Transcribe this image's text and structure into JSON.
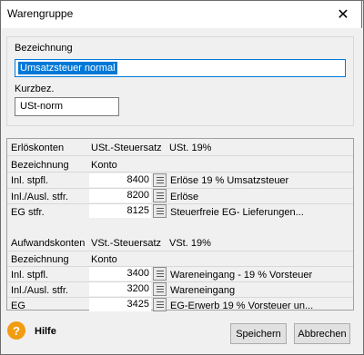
{
  "window": {
    "title": "Warengruppe",
    "close": "✕"
  },
  "form": {
    "bezeichnung_label": "Bezeichnung",
    "bezeichnung_value": "Umsatzsteuer normal",
    "kurzbez_label": "Kurzbez.",
    "kurzbez_value": "USt-norm"
  },
  "erloes": {
    "header_col1": "Erlöskonten",
    "header_col2": "USt.-Steuersatz",
    "header_col3": "USt. 19%",
    "sub_col1": "Bezeichnung",
    "sub_col2": "Konto",
    "rows": [
      {
        "label": "Inl. stpfl.",
        "konto": "8400",
        "desc": "Erlöse 19 % Umsatzsteuer"
      },
      {
        "label": "Inl./Ausl. stfr.",
        "konto": "8200",
        "desc": "Erlöse"
      },
      {
        "label": "EG stfr.",
        "konto": "8125",
        "desc": "Steuerfreie EG- Lieferungen..."
      }
    ]
  },
  "aufwand": {
    "header_col1": "Aufwandskonten",
    "header_col2": "VSt.-Steuersatz",
    "header_col3": "VSt. 19%",
    "sub_col1": "Bezeichnung",
    "sub_col2": "Konto",
    "rows": [
      {
        "label": "Inl. stpfl.",
        "konto": "3400",
        "desc": "Wareneingang - 19 % Vorsteuer"
      },
      {
        "label": "Inl./Ausl. stfr.",
        "konto": "3200",
        "desc": "Wareneingang"
      },
      {
        "label": "EG",
        "konto": "3425",
        "desc": "EG-Erwerb 19 % Vorsteuer un..."
      }
    ]
  },
  "footer": {
    "help_icon": "?",
    "help_label": "Hilfe",
    "save_label": "Speichern",
    "cancel_label": "Abbrechen"
  }
}
